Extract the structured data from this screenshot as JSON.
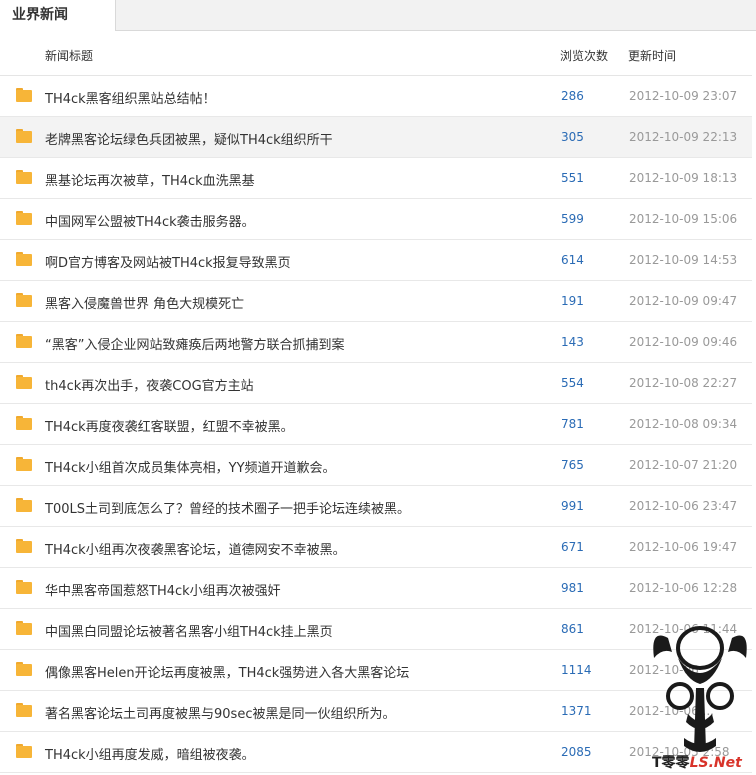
{
  "tab": {
    "label": "业界新闻"
  },
  "columns": {
    "title": "新闻标题",
    "views": "浏览次数",
    "date": "更新时间"
  },
  "rows": [
    {
      "title": "TH4ck黑客组织黑站总结帖！",
      "views": "286",
      "date": "2012-10-09 23:07"
    },
    {
      "title": "老牌黑客论坛绿色兵团被黑，疑似TH4ck组织所干",
      "views": "305",
      "date": "2012-10-09 22:13"
    },
    {
      "title": "黑基论坛再次被草，TH4ck血洗黑基",
      "views": "551",
      "date": "2012-10-09 18:13"
    },
    {
      "title": "中国网军公盟被TH4ck袭击服务器。",
      "views": "599",
      "date": "2012-10-09 15:06"
    },
    {
      "title": "啊D官方博客及网站被TH4ck报复导致黑页",
      "views": "614",
      "date": "2012-10-09 14:53"
    },
    {
      "title": "黑客入侵魔兽世界 角色大规模死亡",
      "views": "191",
      "date": "2012-10-09 09:47"
    },
    {
      "title": "“黑客”入侵企业网站致瘫痪后两地警方联合抓捕到案",
      "views": "143",
      "date": "2012-10-09 09:46"
    },
    {
      "title": "th4ck再次出手，夜袭COG官方主站",
      "views": "554",
      "date": "2012-10-08 22:27"
    },
    {
      "title": "TH4ck再度夜袭红客联盟，红盟不幸被黑。",
      "views": "781",
      "date": "2012-10-08 09:34"
    },
    {
      "title": "TH4ck小组首次成员集体亮相，YY频道开道歉会。",
      "views": "765",
      "date": "2012-10-07 21:20"
    },
    {
      "title": "T00LS土司到底怎么了？曾经的技术圈子一把手论坛连续被黑。",
      "views": "991",
      "date": "2012-10-06 23:47"
    },
    {
      "title": "TH4ck小组再次夜袭黑客论坛，道德网安不幸被黑。",
      "views": "671",
      "date": "2012-10-06 19:47"
    },
    {
      "title": "华中黑客帝国惹怒TH4ck小组再次被强奸",
      "views": "981",
      "date": "2012-10-06 12:28"
    },
    {
      "title": "中国黑白同盟论坛被著名黑客小组TH4ck挂上黑页",
      "views": "861",
      "date": "2012-10-06 11:44"
    },
    {
      "title": "偶像黑客Helen开论坛再度被黑，TH4ck强势进入各大黑客论坛",
      "views": "1114",
      "date": "2012-10-06 ..."
    },
    {
      "title": "著名黑客论坛土司再度被黑与90sec被黑是同一伙组织所为。",
      "views": "1371",
      "date": "2012-10-06 ..."
    },
    {
      "title": "TH4ck小组再度发威，暗组被夜袭。",
      "views": "2085",
      "date": "2012-10-05 2:58"
    }
  ],
  "watermark": {
    "prefix": "T零零",
    "mid": "LS",
    "suffix": ".Net"
  },
  "colors": {
    "folder": "#f7b538",
    "views": "#2a6bb5",
    "date": "#999999"
  },
  "icons": {
    "row": "folder-icon"
  }
}
